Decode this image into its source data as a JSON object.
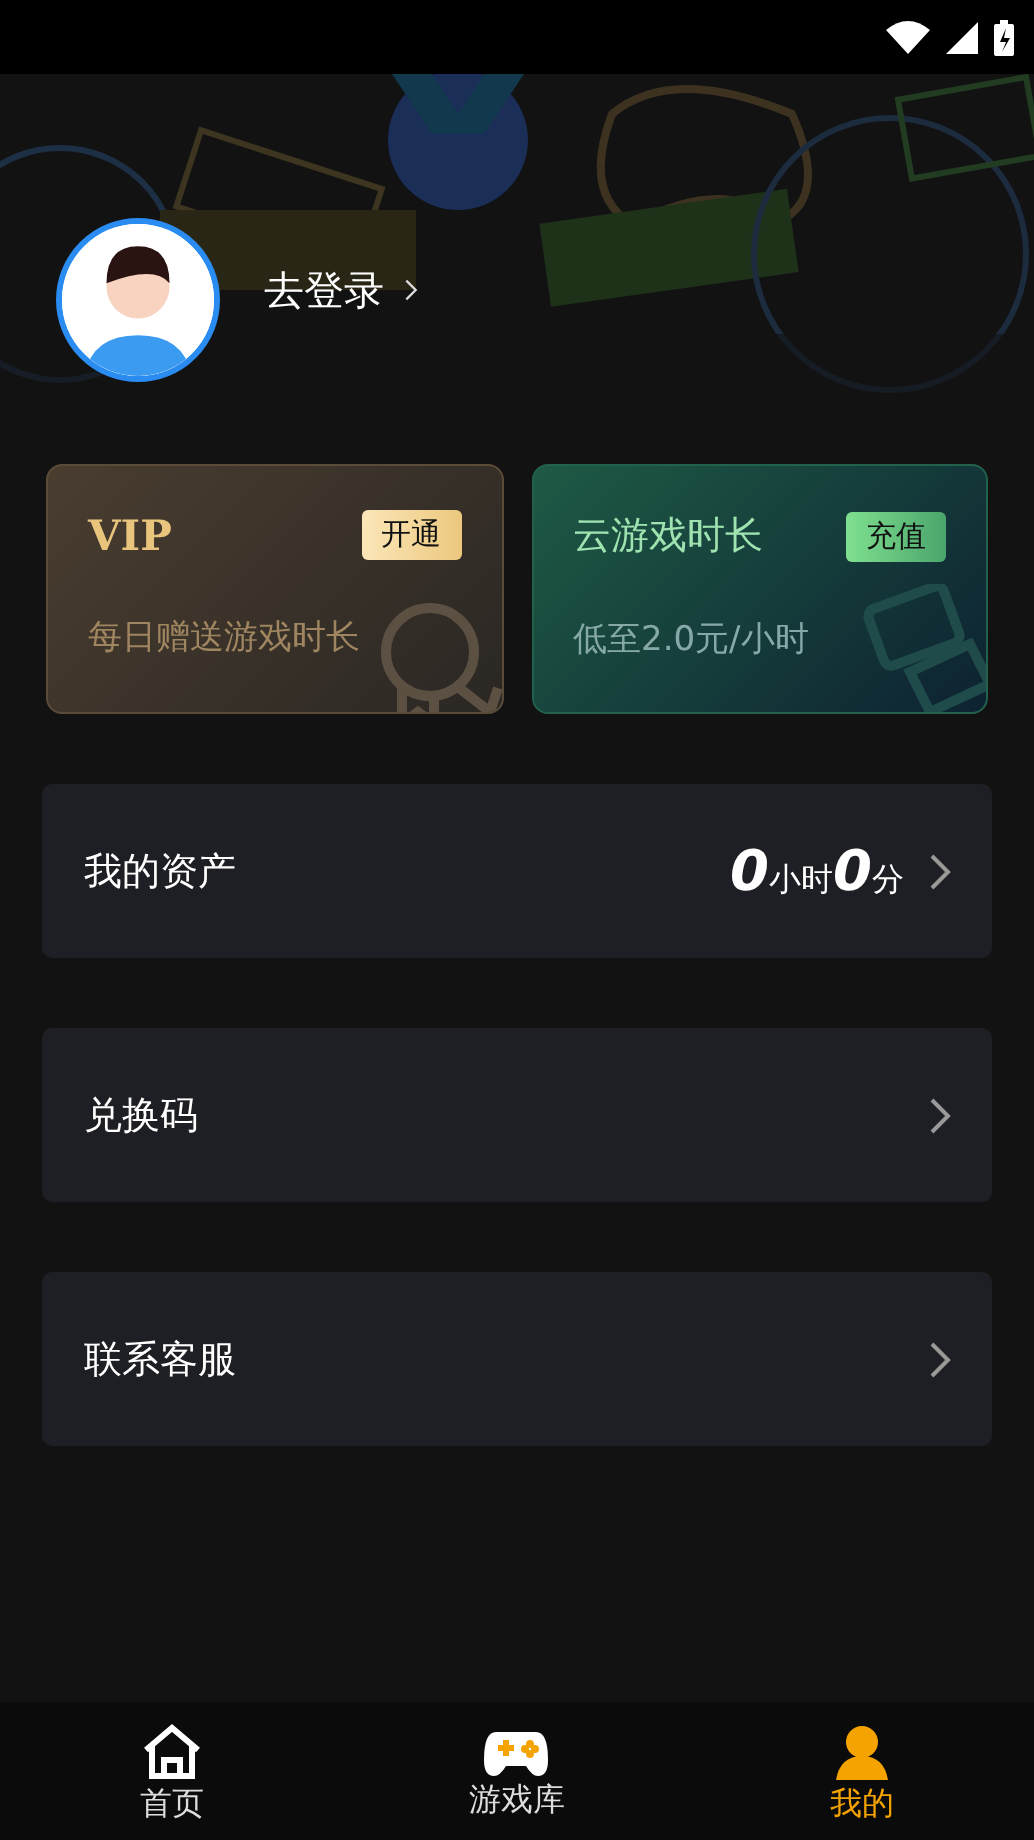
{
  "profile": {
    "login_label": "去登录"
  },
  "cards": [
    {
      "kind": "vip",
      "title": "VIP",
      "button": "开通",
      "subtitle": "每日赠送游戏时长"
    },
    {
      "kind": "cloud",
      "title": "云游戏时长",
      "button": "充值",
      "subtitle": "低至2.0元/小时"
    }
  ],
  "menu": [
    {
      "kind": "assets",
      "label": "我的资产",
      "hours": "0",
      "hour_unit": "小时",
      "minutes": "0",
      "minute_unit": "分"
    },
    {
      "kind": "plain",
      "label": "兑换码"
    },
    {
      "kind": "plain",
      "label": "联系客服"
    }
  ],
  "tabs": [
    {
      "kind": "home",
      "label": "首页",
      "selected": false
    },
    {
      "kind": "games",
      "label": "游戏库",
      "selected": false
    },
    {
      "kind": "me",
      "label": "我的",
      "selected": true
    }
  ]
}
